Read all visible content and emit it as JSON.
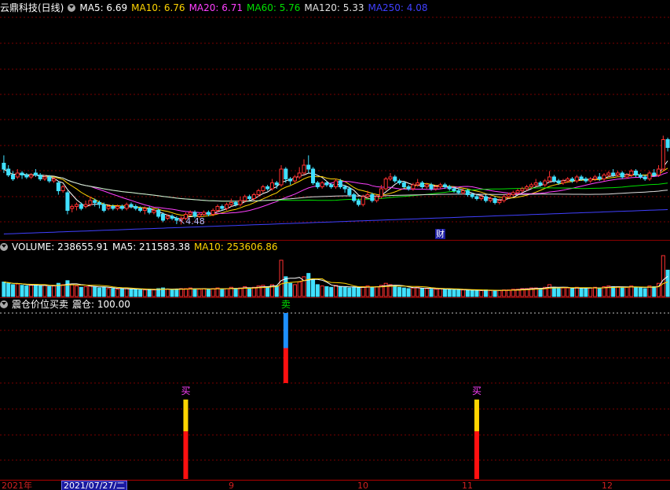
{
  "title": "云鼎科技(日线)",
  "ma": [
    {
      "label": "MA5: 6.69",
      "color": "#ffffff"
    },
    {
      "label": "MA10: 6.76",
      "color": "#ffd400"
    },
    {
      "label": "MA20: 6.71",
      "color": "#ff40ff"
    },
    {
      "label": "MA60: 5.76",
      "color": "#00e000"
    },
    {
      "label": "MA120: 5.33",
      "color": "#e0e0e0"
    },
    {
      "label": "MA250: 4.08",
      "color": "#4040ff"
    }
  ],
  "low_marker": "4.48",
  "finance_badge": "财",
  "volume": {
    "title": "VOLUME: 238655.91",
    "ma5": "MA5: 211583.38",
    "ma10": "MA10: 253606.86"
  },
  "indicator": {
    "title": "震仓价位买卖",
    "value": "震仓: 100.00",
    "signals": [
      {
        "label": "买",
        "color": "#ff40ff",
        "bar_index": 40
      },
      {
        "label": "卖",
        "color": "#00e000",
        "bar_index": 62
      },
      {
        "label": "买",
        "color": "#ff40ff",
        "bar_index": 104
      }
    ]
  },
  "timeaxis": {
    "labels": [
      {
        "text": "2021年"
      },
      {
        "text": "9"
      },
      {
        "text": "10"
      },
      {
        "text": "11"
      },
      {
        "text": "12"
      }
    ],
    "selected": "2021/07/27/二"
  },
  "chart_data": {
    "type": "candlestick",
    "x_axis": "trading days",
    "candles": [
      [
        7.6,
        7.3,
        8.0,
        7.1
      ],
      [
        7.3,
        7.0,
        7.5,
        6.9
      ],
      [
        7.0,
        6.8,
        7.2,
        6.7
      ],
      [
        6.9,
        7.1,
        7.3,
        6.8
      ],
      [
        7.1,
        7.0,
        7.2,
        6.8
      ],
      [
        7.0,
        6.9,
        7.1,
        6.8
      ],
      [
        6.9,
        7.0,
        7.1,
        6.8
      ],
      [
        7.1,
        7.0,
        7.3,
        6.9
      ],
      [
        7.0,
        6.8,
        7.1,
        6.7
      ],
      [
        6.8,
        6.9,
        7.0,
        6.7
      ],
      [
        6.9,
        6.7,
        7.0,
        6.6
      ],
      [
        6.7,
        6.8,
        6.9,
        6.6
      ],
      [
        6.6,
        6.2,
        6.7,
        6.0
      ],
      [
        6.2,
        6.4,
        6.5,
        6.1
      ],
      [
        6.1,
        5.2,
        6.2,
        5.0
      ],
      [
        5.3,
        5.4,
        5.5,
        5.1
      ],
      [
        5.4,
        5.5,
        5.6,
        5.2
      ],
      [
        5.5,
        5.3,
        5.6,
        5.2
      ],
      [
        5.4,
        5.5,
        5.7,
        5.3
      ],
      [
        5.5,
        5.7,
        5.9,
        5.4
      ],
      [
        5.7,
        5.6,
        5.8,
        5.4
      ],
      [
        5.6,
        5.5,
        5.7,
        5.3
      ],
      [
        5.5,
        5.2,
        5.6,
        5.1
      ],
      [
        5.3,
        5.4,
        5.5,
        5.2
      ],
      [
        5.4,
        5.3,
        5.5,
        5.2
      ],
      [
        5.3,
        5.4,
        5.5,
        5.2
      ],
      [
        5.4,
        5.3,
        5.5,
        5.2
      ],
      [
        5.3,
        5.5,
        5.6,
        5.2
      ],
      [
        5.5,
        5.4,
        5.6,
        5.3
      ],
      [
        5.4,
        5.3,
        5.5,
        5.2
      ],
      [
        5.3,
        5.2,
        5.4,
        5.1
      ],
      [
        5.2,
        5.3,
        5.4,
        5.0
      ],
      [
        5.3,
        5.1,
        5.4,
        5.0
      ],
      [
        5.1,
        5.2,
        5.3,
        5.0
      ],
      [
        5.2,
        4.9,
        5.3,
        4.8
      ],
      [
        5.0,
        4.7,
        5.1,
        4.6
      ],
      [
        4.8,
        4.9,
        5.0,
        4.7
      ],
      [
        4.9,
        4.8,
        5.0,
        4.7
      ],
      [
        4.8,
        4.7,
        4.9,
        4.5
      ],
      [
        4.7,
        4.8,
        4.9,
        4.48
      ],
      [
        4.8,
        5.0,
        5.1,
        4.7
      ],
      [
        5.0,
        5.1,
        5.2,
        4.9
      ],
      [
        5.1,
        4.9,
        5.2,
        4.8
      ],
      [
        4.9,
        5.0,
        5.1,
        4.8
      ],
      [
        5.0,
        5.1,
        5.2,
        4.9
      ],
      [
        5.1,
        5.0,
        5.2,
        4.9
      ],
      [
        5.0,
        5.2,
        5.3,
        4.9
      ],
      [
        5.2,
        5.4,
        5.5,
        5.1
      ],
      [
        5.4,
        5.3,
        5.5,
        5.2
      ],
      [
        5.3,
        5.5,
        5.6,
        5.2
      ],
      [
        5.5,
        5.6,
        5.8,
        5.4
      ],
      [
        5.6,
        5.5,
        5.7,
        5.4
      ],
      [
        5.5,
        5.7,
        5.9,
        5.4
      ],
      [
        5.7,
        5.9,
        6.0,
        5.6
      ],
      [
        5.9,
        5.8,
        6.0,
        5.7
      ],
      [
        5.8,
        6.0,
        6.1,
        5.7
      ],
      [
        6.0,
        6.2,
        6.3,
        5.9
      ],
      [
        6.2,
        6.4,
        6.5,
        6.1
      ],
      [
        6.4,
        6.3,
        6.5,
        6.2
      ],
      [
        6.3,
        6.6,
        6.8,
        6.2
      ],
      [
        6.6,
        6.5,
        6.7,
        6.3
      ],
      [
        6.5,
        7.3,
        7.5,
        6.4
      ],
      [
        7.3,
        6.8,
        7.4,
        6.6
      ],
      [
        6.8,
        6.7,
        6.9,
        6.5
      ],
      [
        6.7,
        6.9,
        7.0,
        6.6
      ],
      [
        6.9,
        7.1,
        7.4,
        6.8
      ],
      [
        7.1,
        7.5,
        7.8,
        7.0
      ],
      [
        7.5,
        7.3,
        8.0,
        7.1
      ],
      [
        7.3,
        6.6,
        7.4,
        6.5
      ],
      [
        6.6,
        6.4,
        6.7,
        6.3
      ],
      [
        6.4,
        6.6,
        6.7,
        6.3
      ],
      [
        6.6,
        6.5,
        6.7,
        6.4
      ],
      [
        6.5,
        6.4,
        6.6,
        6.3
      ],
      [
        6.4,
        6.7,
        6.8,
        6.3
      ],
      [
        6.7,
        6.4,
        6.8,
        6.3
      ],
      [
        6.4,
        6.3,
        6.5,
        6.1
      ],
      [
        6.3,
        6.0,
        6.4,
        5.9
      ],
      [
        6.0,
        5.7,
        6.1,
        5.6
      ],
      [
        5.7,
        5.5,
        5.8,
        5.4
      ],
      [
        5.5,
        5.9,
        6.0,
        5.4
      ],
      [
        5.9,
        6.0,
        6.2,
        5.8
      ],
      [
        6.0,
        5.7,
        6.1,
        5.6
      ],
      [
        5.7,
        5.9,
        6.0,
        5.6
      ],
      [
        5.9,
        6.3,
        6.5,
        5.8
      ],
      [
        6.3,
        6.8,
        6.9,
        6.2
      ],
      [
        6.8,
        6.9,
        7.1,
        6.7
      ],
      [
        6.9,
        6.7,
        7.0,
        6.6
      ],
      [
        6.7,
        6.6,
        6.8,
        6.5
      ],
      [
        6.6,
        6.4,
        6.7,
        6.3
      ],
      [
        6.4,
        6.3,
        6.5,
        6.2
      ],
      [
        6.3,
        6.5,
        6.6,
        6.2
      ],
      [
        6.5,
        6.6,
        6.8,
        6.4
      ],
      [
        6.6,
        6.4,
        6.7,
        6.3
      ],
      [
        6.4,
        6.5,
        6.6,
        6.3
      ],
      [
        6.5,
        6.3,
        6.6,
        6.2
      ],
      [
        6.3,
        6.4,
        6.5,
        6.2
      ],
      [
        6.4,
        6.5,
        6.6,
        6.3
      ],
      [
        6.5,
        6.4,
        6.6,
        6.3
      ],
      [
        6.4,
        6.3,
        6.5,
        6.2
      ],
      [
        6.3,
        6.2,
        6.4,
        6.1
      ],
      [
        6.2,
        6.1,
        6.3,
        6.0
      ],
      [
        6.1,
        6.2,
        6.3,
        6.0
      ],
      [
        6.2,
        6.0,
        6.3,
        5.9
      ],
      [
        6.0,
        5.9,
        6.1,
        5.8
      ],
      [
        5.9,
        5.8,
        6.0,
        5.7
      ],
      [
        5.8,
        5.9,
        6.0,
        5.7
      ],
      [
        5.9,
        5.7,
        6.0,
        5.6
      ],
      [
        5.7,
        5.8,
        5.9,
        5.6
      ],
      [
        5.8,
        5.6,
        5.9,
        5.5
      ],
      [
        5.6,
        5.7,
        5.8,
        5.5
      ],
      [
        5.7,
        5.9,
        6.0,
        5.6
      ],
      [
        5.9,
        6.0,
        6.1,
        5.8
      ],
      [
        6.0,
        6.1,
        6.2,
        5.9
      ],
      [
        6.1,
        6.2,
        6.3,
        6.0
      ],
      [
        6.2,
        6.3,
        6.4,
        6.1
      ],
      [
        6.3,
        6.4,
        6.5,
        6.2
      ],
      [
        6.4,
        6.5,
        6.6,
        6.3
      ],
      [
        6.5,
        6.6,
        6.8,
        6.4
      ],
      [
        6.6,
        6.5,
        6.7,
        6.4
      ],
      [
        6.5,
        6.7,
        6.8,
        6.4
      ],
      [
        6.7,
        6.9,
        7.2,
        6.6
      ],
      [
        6.9,
        6.7,
        7.0,
        6.6
      ],
      [
        6.7,
        6.6,
        6.8,
        6.5
      ],
      [
        6.6,
        6.7,
        6.8,
        6.5
      ],
      [
        6.7,
        6.8,
        6.9,
        6.6
      ],
      [
        6.8,
        6.7,
        6.9,
        6.6
      ],
      [
        6.7,
        6.9,
        7.0,
        6.6
      ],
      [
        6.9,
        6.8,
        7.0,
        6.7
      ],
      [
        6.8,
        6.7,
        6.9,
        6.6
      ],
      [
        6.7,
        6.8,
        6.9,
        6.6
      ],
      [
        6.8,
        6.9,
        7.0,
        6.7
      ],
      [
        6.9,
        6.8,
        7.1,
        6.7
      ],
      [
        6.8,
        7.0,
        7.1,
        6.7
      ],
      [
        7.0,
        7.1,
        7.2,
        6.9
      ],
      [
        7.1,
        7.0,
        7.3,
        6.9
      ],
      [
        7.0,
        7.1,
        7.2,
        6.9
      ],
      [
        7.1,
        6.9,
        7.2,
        6.8
      ],
      [
        6.9,
        7.0,
        7.1,
        6.8
      ],
      [
        7.0,
        7.2,
        7.3,
        6.9
      ],
      [
        7.2,
        7.0,
        7.3,
        6.9
      ],
      [
        7.0,
        6.9,
        7.1,
        6.8
      ],
      [
        6.9,
        6.8,
        7.0,
        6.7
      ],
      [
        6.8,
        7.1,
        7.2,
        6.7
      ],
      [
        7.1,
        7.0,
        7.3,
        6.9
      ],
      [
        7.0,
        7.3,
        7.5,
        6.9
      ],
      [
        7.3,
        8.8,
        9.0,
        7.2
      ],
      [
        8.8,
        8.4,
        8.9,
        8.2
      ]
    ],
    "ma_lines": {
      "MA5": "#ffffff",
      "MA10": "#ffd400",
      "MA20": "#ff40ff",
      "MA60": "#00e000",
      "MA120": "#e0e0e0",
      "MA250": "#4040ff"
    },
    "y_range": [
      4.3,
      8.9
    ],
    "volume": [
      0.22,
      0.2,
      0.18,
      0.19,
      0.17,
      0.16,
      0.17,
      0.18,
      0.16,
      0.17,
      0.15,
      0.16,
      0.2,
      0.18,
      0.24,
      0.18,
      0.16,
      0.14,
      0.15,
      0.16,
      0.15,
      0.13,
      0.14,
      0.12,
      0.12,
      0.11,
      0.12,
      0.12,
      0.11,
      0.11,
      0.1,
      0.1,
      0.11,
      0.1,
      0.12,
      0.13,
      0.11,
      0.1,
      0.11,
      0.12,
      0.12,
      0.13,
      0.11,
      0.11,
      0.12,
      0.11,
      0.12,
      0.13,
      0.11,
      0.12,
      0.14,
      0.12,
      0.13,
      0.15,
      0.12,
      0.14,
      0.16,
      0.17,
      0.15,
      0.18,
      0.16,
      0.55,
      0.3,
      0.2,
      0.18,
      0.22,
      0.3,
      0.35,
      0.25,
      0.18,
      0.16,
      0.15,
      0.14,
      0.17,
      0.15,
      0.14,
      0.13,
      0.14,
      0.13,
      0.15,
      0.16,
      0.14,
      0.15,
      0.17,
      0.2,
      0.18,
      0.16,
      0.14,
      0.13,
      0.12,
      0.13,
      0.14,
      0.12,
      0.12,
      0.11,
      0.11,
      0.12,
      0.11,
      0.11,
      0.1,
      0.1,
      0.1,
      0.09,
      0.1,
      0.09,
      0.09,
      0.1,
      0.09,
      0.09,
      0.09,
      0.1,
      0.1,
      0.11,
      0.11,
      0.12,
      0.12,
      0.13,
      0.13,
      0.12,
      0.14,
      0.18,
      0.14,
      0.12,
      0.13,
      0.13,
      0.12,
      0.14,
      0.13,
      0.12,
      0.13,
      0.14,
      0.13,
      0.15,
      0.16,
      0.15,
      0.15,
      0.13,
      0.14,
      0.16,
      0.14,
      0.13,
      0.12,
      0.16,
      0.15,
      0.2,
      0.62,
      0.4
    ],
    "volume_range": [
      0,
      0.62
    ],
    "indicator": {
      "reference_level": 100,
      "bars": [
        {
          "index": 40,
          "segments": [
            {
              "color": "#ffd400",
              "fraction": 0.4
            },
            {
              "color": "#ff1010",
              "fraction": 0.6
            }
          ]
        },
        {
          "index": 62,
          "segments": [
            {
              "color": "#1e90ff",
              "fraction": 0.5
            },
            {
              "color": "#ff1010",
              "fraction": 0.5
            }
          ]
        },
        {
          "index": 104,
          "segments": [
            {
              "color": "#ffd400",
              "fraction": 0.4
            },
            {
              "color": "#ff1010",
              "fraction": 0.6
            }
          ]
        }
      ]
    }
  }
}
